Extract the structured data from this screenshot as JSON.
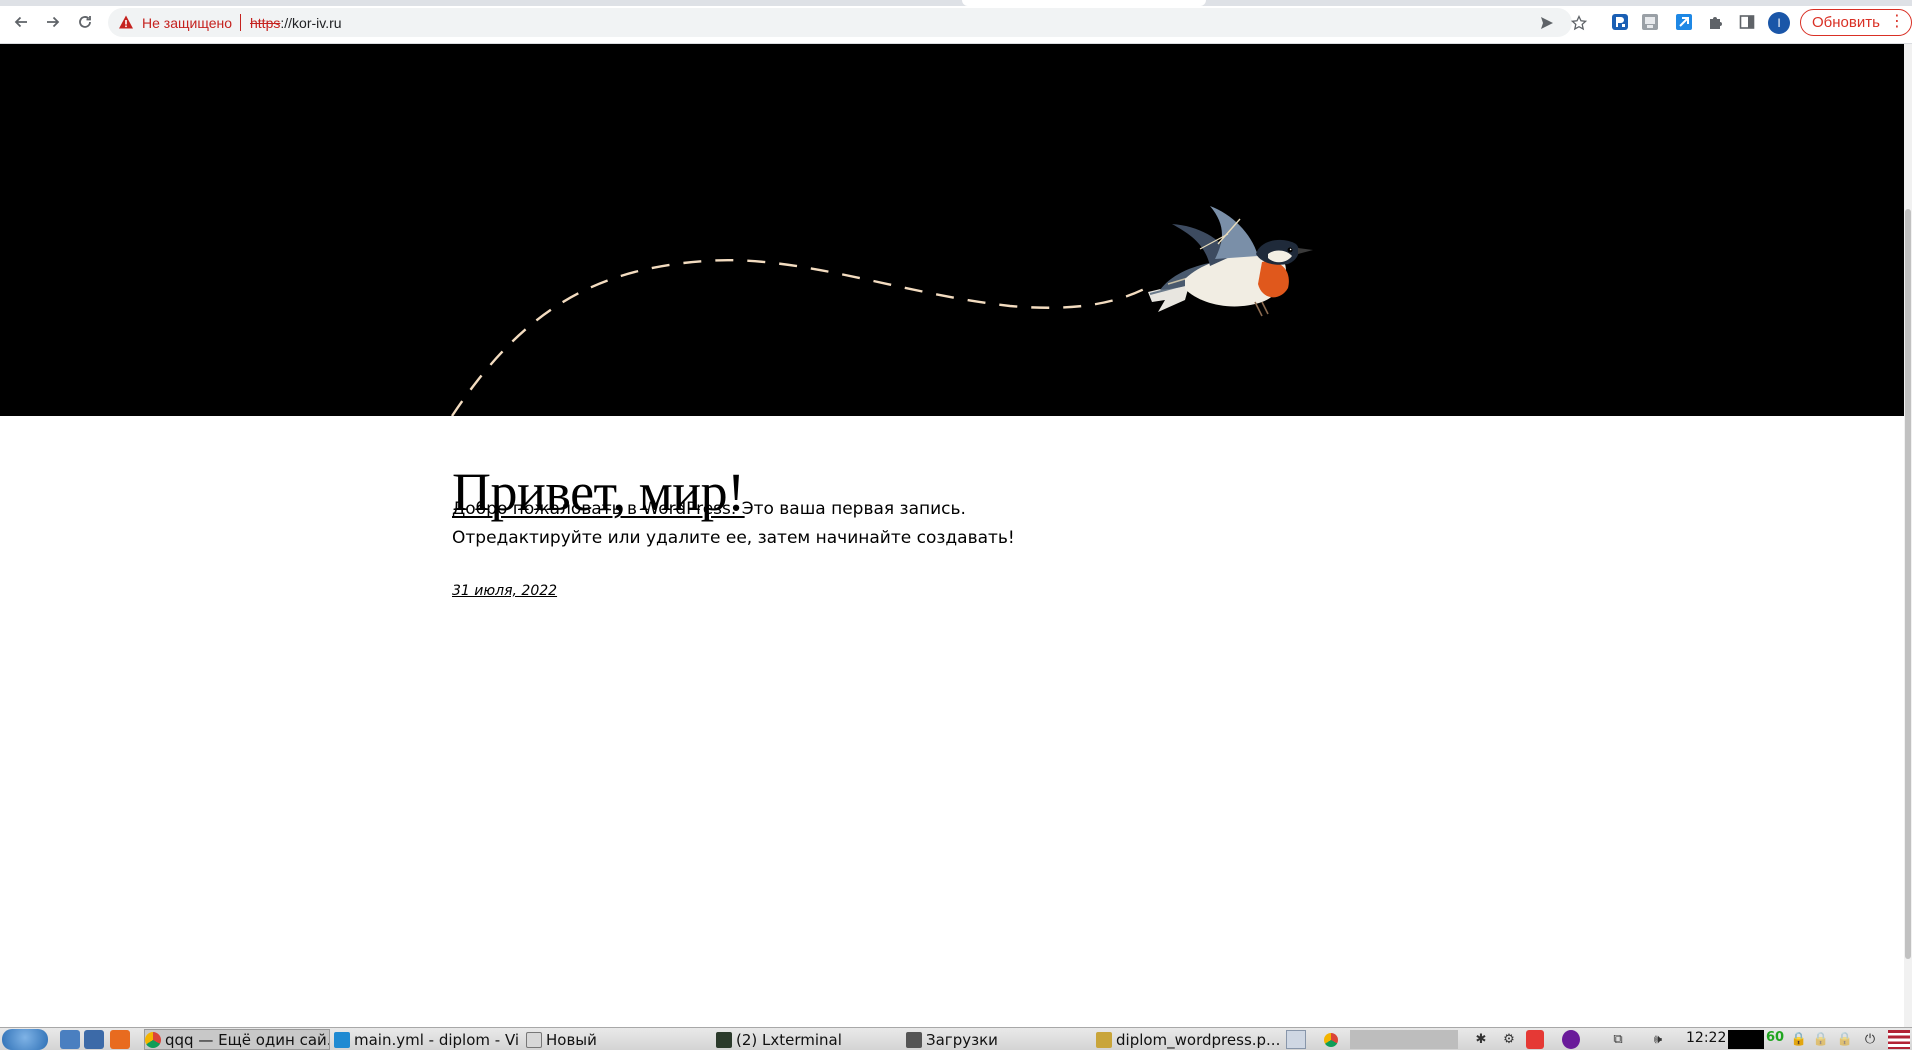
{
  "browser": {
    "nav": {
      "back_icon": "arrow-left-icon",
      "forward_icon": "arrow-right-icon",
      "reload_icon": "reload-icon"
    },
    "omnibox": {
      "security_text": "Не защищено",
      "url_scheme": "https",
      "url_rest": "://kor-iv.ru"
    },
    "profile_initial": "I",
    "update_label": "Обновить",
    "menu_icon": "⋮"
  },
  "page": {
    "post_title": "Привет, мир!",
    "post_body": "Добро пожаловать в WordPress. Это ваша первая запись. Отредактируйте или удалите ее, затем начинайте создавать!",
    "post_date": "31 июля, 2022",
    "hero_background": "#000000",
    "flight_path_color": "#f3dcc0"
  },
  "taskbar": {
    "tasks": [
      {
        "label": "qqq — Ещё один сай...",
        "icon": "chrome-icon"
      },
      {
        "label": "main.yml - diplom - Vi...",
        "icon": "vscode-icon"
      },
      {
        "label": "Новый",
        "icon": "text-editor-icon"
      },
      {
        "label": "(2) Lxterminal",
        "icon": "terminal-icon"
      },
      {
        "label": "Загрузки",
        "icon": "folder-icon"
      },
      {
        "label": "diplom_wordpress.p...",
        "icon": "image-viewer-icon"
      }
    ],
    "clock": "12:22",
    "cpu_value": "60"
  }
}
